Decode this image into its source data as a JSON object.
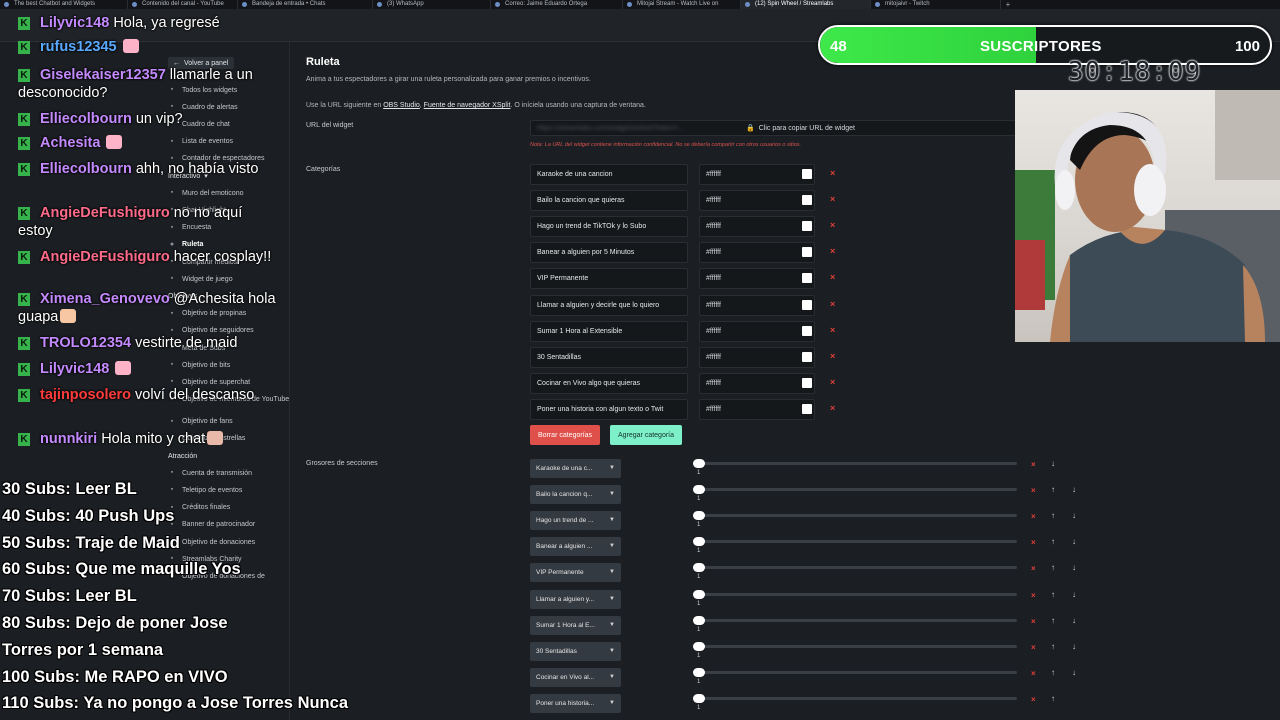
{
  "browser": {
    "tabs": [
      {
        "label": "The best Chatbot and Widgets",
        "active": false
      },
      {
        "label": "Contenido del canal - YouTube",
        "active": false
      },
      {
        "label": "Bandeja de entrada • Chats",
        "active": false
      },
      {
        "label": "(3) WhatsApp",
        "active": false
      },
      {
        "label": "Correo: Jaime Eduardo Ortega",
        "active": false
      },
      {
        "label": "Mitojai Stream - Watch Live on",
        "active": false
      },
      {
        "label": "(12) Spin Wheel / Streamlabs",
        "active": true
      },
      {
        "label": "mitojaivr - Twitch",
        "active": false
      }
    ],
    "new_tab": "+"
  },
  "sidebar": {
    "back": "Volver a panel",
    "items": [
      {
        "label": "Todos los widgets",
        "icon": "grid-icon"
      },
      {
        "label": "Cuadro de alertas",
        "icon": "bell-icon"
      },
      {
        "label": "Cuadro de chat",
        "icon": "chat-icon"
      },
      {
        "label": "Lista de eventos",
        "icon": "list-icon"
      },
      {
        "label": "Contador de espectadores",
        "icon": "eye-icon"
      },
      {
        "label": "Interactivo",
        "icon": "chevron-down-icon",
        "head": true
      },
      {
        "label": "Muro del emoticono",
        "icon": "smile-icon"
      },
      {
        "label": "Chat Highlight",
        "icon": "star-icon"
      },
      {
        "label": "Encuesta",
        "icon": "poll-icon"
      },
      {
        "label": "Ruleta",
        "icon": "wheel-icon",
        "active": true
      },
      {
        "label": "Compartir medios",
        "icon": "media-icon"
      },
      {
        "label": "Widget de juego",
        "icon": "game-icon"
      },
      {
        "label": "Objetivos",
        "icon": "",
        "head": true
      },
      {
        "label": "Objetivo de propinas",
        "icon": "tip-icon"
      },
      {
        "label": "Objetivo de seguidores",
        "icon": "user-icon"
      },
      {
        "label": "Meta de Subs",
        "icon": "sub-icon"
      },
      {
        "label": "Objetivo de bits",
        "icon": "bits-icon"
      },
      {
        "label": "Objetivo de superchat",
        "icon": "superchat-icon"
      },
      {
        "label": "Objetivo de miembros de YouTube",
        "icon": "youtube-icon"
      },
      {
        "label": "Objetivo de fans",
        "icon": "fan-icon"
      },
      {
        "label": "Objetivo de estrellas",
        "icon": "star-icon"
      },
      {
        "label": "Atracción",
        "icon": "",
        "head": true
      },
      {
        "label": "Cuenta de transmisión",
        "icon": "clock-icon"
      },
      {
        "label": "Teletipo de eventos",
        "icon": "ticker-icon"
      },
      {
        "label": "Créditos finales",
        "icon": "credits-icon"
      },
      {
        "label": "Banner de patrocinador",
        "icon": "banner-icon"
      },
      {
        "label": "Objetivo de donaciones",
        "icon": "donate-icon"
      },
      {
        "label": "Streamlabs Charity",
        "icon": "heart-icon"
      },
      {
        "label": "Objetivo de donaciones de",
        "icon": "donate-icon"
      }
    ]
  },
  "main": {
    "title": "Ruleta",
    "description": "Anima a tus espectadores a girar una ruleta personalizada para ganar premios o incentivos.",
    "url_note_prefix": "Use la URL siguiente en",
    "url_note_link1": "OBS Studio",
    "url_note_sep": ",",
    "url_note_link2": "Fuente de navegador XSplit",
    "url_note_suffix": ". O iníciela usando una captura de ventana.",
    "widget_url_label": "URL del widget",
    "widget_url_hidden": "https://streamlabs.com/widgets/wheel?token=...",
    "copy_url": "Clic para copiar URL de widget",
    "red_note": "Nota: La URL del widget contiene información confidencial. No se debería compartir con otros usuarios o sitios.",
    "categories_label": "Categorías",
    "categories": [
      {
        "name": "Karaoke de una cancion",
        "color": "#ffffff"
      },
      {
        "name": "Bailo la cancion que quieras",
        "color": "#ffffff"
      },
      {
        "name": "Hago un trend de TikTOk y lo Subo",
        "color": "#ffffff"
      },
      {
        "name": "Banear a alguien por 5 Minutos",
        "color": "#ffffff"
      },
      {
        "name": "VIP Permanente",
        "color": "#ffffff"
      },
      {
        "name": "Llamar a alguien y decirle que lo quiero",
        "color": "#ffffff"
      },
      {
        "name": "Sumar 1 Hora al Extensible",
        "color": "#ffffff"
      },
      {
        "name": "30 Sentadillas",
        "color": "#ffffff"
      },
      {
        "name": "Cocinar en Vivo algo que quieras",
        "color": "#ffffff"
      },
      {
        "name": "Poner una historia con algun texto o Twit",
        "color": "#ffffff"
      }
    ],
    "delete_categories": "Borrar categorías",
    "add_category": "Agregar categoría",
    "sections_label": "Grosores de secciones",
    "sections": [
      {
        "name": "Karaoke de una c...",
        "value": "1"
      },
      {
        "name": "Bailo la cancion q...",
        "value": "1"
      },
      {
        "name": "Hago un trend de ...",
        "value": "1"
      },
      {
        "name": "Banear a alguien ...",
        "value": "1"
      },
      {
        "name": "VIP Permanente",
        "value": "1"
      },
      {
        "name": "Llamar a alguien y...",
        "value": "1"
      },
      {
        "name": "Sumar 1 Hora al E...",
        "value": "1"
      },
      {
        "name": "30 Sentadillas",
        "value": "1"
      },
      {
        "name": "Cocinar en Vivo al...",
        "value": "1"
      },
      {
        "name": "Poner una historia...",
        "value": "1"
      }
    ]
  },
  "chat": [
    {
      "user": "Lilyvic148",
      "color": "#c48aff",
      "text": "Hola, ya regresé",
      "emote": false
    },
    {
      "user": "rufus12345",
      "color": "#5aa9ff",
      "text": "",
      "emote": true
    },
    {
      "user": "Giselekaiser12357",
      "color": "#c48aff",
      "text": "llamarle a un desconocido?",
      "emote": false
    },
    {
      "user": "Elliecolbourn",
      "color": "#c48aff",
      "text": "un vip?",
      "emote": false
    },
    {
      "user": "Achesita",
      "color": "#c48aff",
      "text": "",
      "emote": true
    },
    {
      "user": "Elliecolbourn",
      "color": "#c48aff",
      "text": "ahh, no había visto",
      "emote": false
    },
    {
      "user": "AngieDeFushiguro",
      "color": "#ff6b8a",
      "text": "no no aquí estoy",
      "emote": false
    },
    {
      "user": "AngieDeFushiguro",
      "color": "#ff6b8a",
      "text": "hacer cosplay!!",
      "emote": false
    },
    {
      "user": "Ximena_Genovevo",
      "color": "#c48aff",
      "text": "@Achesita hola guapa",
      "emote": true
    },
    {
      "user": "TROLO12354",
      "color": "#c48aff",
      "text": "vestirte de maid",
      "emote": false
    },
    {
      "user": "Lilyvic148",
      "color": "#c48aff",
      "text": "",
      "emote": true
    },
    {
      "user": "tajinposolero",
      "color": "#ff3b3b",
      "text": "volví del descanso",
      "emote": false
    },
    {
      "user": "nunnkiri",
      "color": "#c48aff",
      "text": "Hola mito y chat",
      "emote": true
    }
  ],
  "goals": [
    "30 Subs: Leer BL",
    "40 Subs: 40 Push Ups",
    "50 Subs: Traje de Maid",
    "60 Subs: Que me maquille Yos",
    "70 Subs: Leer BL",
    "80 Subs: Dejo de poner Jose",
    "Torres por 1 semana",
    "100 Subs: Me RAPO en VIVO",
    "110 Subs: Ya no pongo a Jose Torres Nunca"
  ],
  "subgoal": {
    "current": "48",
    "label": "SUSCRIPTORES",
    "target": "100",
    "progress": 0.48
  },
  "timer": "30:18:09",
  "colors": {
    "accent_green": "#3ee84a",
    "delete_red": "#e0504a",
    "add_mint": "#7ef0c9"
  }
}
